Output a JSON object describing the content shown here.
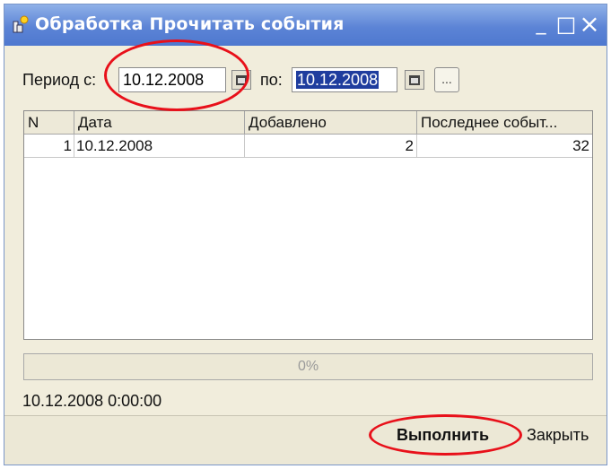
{
  "window": {
    "title": "Обработка  Прочитать события",
    "minimize": "_",
    "maximize": "□",
    "close": "×"
  },
  "period": {
    "from_label": "Период с:",
    "from_value": "10.12.2008",
    "to_label": "по:",
    "to_value": "10.12.2008",
    "dots_label": "..."
  },
  "table": {
    "columns": [
      "N",
      "Дата",
      "Добавлено",
      "Последнее событ..."
    ],
    "rows": [
      {
        "n": "1",
        "date": "10.12.2008",
        "added": "2",
        "last_event": "32"
      }
    ]
  },
  "progress": {
    "text": "0%",
    "value": 0
  },
  "status_text": "10.12.2008 0:00:00",
  "buttons": {
    "run": "Выполнить",
    "close": "Закрыть"
  },
  "icons": [
    "app-icon",
    "calendar-icon"
  ],
  "colors": {
    "titlebar": "#5c84d6",
    "annotation": "#e8101a",
    "selection": "#1f3d9e"
  }
}
